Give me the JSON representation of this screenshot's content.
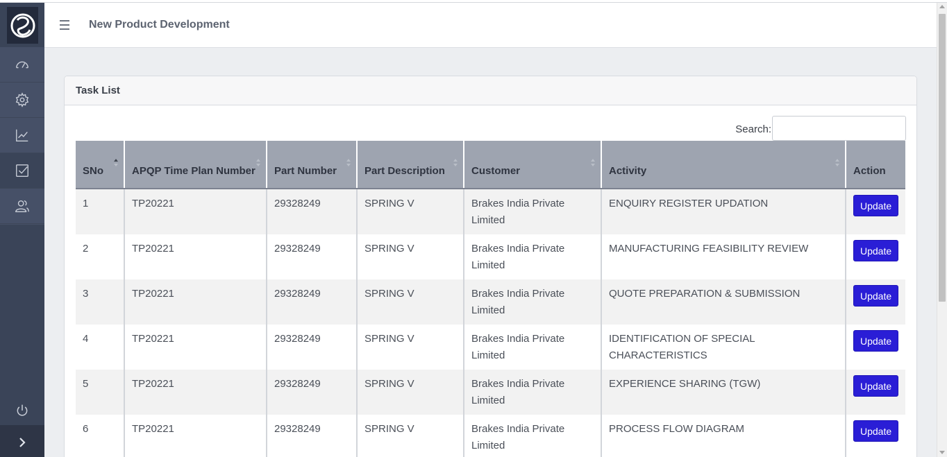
{
  "app": {
    "title": "New Product Development"
  },
  "sidebar": {
    "logo": "swirl-logo",
    "items": [
      {
        "name": "dashboard-icon",
        "label": "Dashboard"
      },
      {
        "name": "settings-icon",
        "label": "Settings"
      },
      {
        "name": "chart-icon",
        "label": "Reports"
      },
      {
        "name": "tasks-icon",
        "label": "Tasks",
        "active": true
      },
      {
        "name": "users-icon",
        "label": "Users"
      }
    ],
    "footer": [
      "power-icon",
      "chevron-right-icon"
    ]
  },
  "card": {
    "title": "Task List"
  },
  "search": {
    "label": "Search:",
    "value": ""
  },
  "table": {
    "columns": [
      "SNo",
      "APQP Time Plan Number",
      "Part Number",
      "Part Description",
      "Customer",
      "Activity",
      "Action"
    ],
    "rows": [
      {
        "sno": "1",
        "plan": "TP20221",
        "part": "29328249",
        "desc": "SPRING V",
        "customer": "Brakes India Private Limited",
        "activity": "ENQUIRY REGISTER UPDATION",
        "action": "Update"
      },
      {
        "sno": "2",
        "plan": "TP20221",
        "part": "29328249",
        "desc": "SPRING V",
        "customer": "Brakes India Private Limited",
        "activity": "MANUFACTURING FEASIBILITY REVIEW",
        "action": "Update"
      },
      {
        "sno": "3",
        "plan": "TP20221",
        "part": "29328249",
        "desc": "SPRING V",
        "customer": "Brakes India Private Limited",
        "activity": "QUOTE PREPARATION & SUBMISSION",
        "action": "Update"
      },
      {
        "sno": "4",
        "plan": "TP20221",
        "part": "29328249",
        "desc": "SPRING V",
        "customer": "Brakes India Private Limited",
        "activity": "IDENTIFICATION OF SPECIAL CHARACTERISTICS",
        "action": "Update"
      },
      {
        "sno": "5",
        "plan": "TP20221",
        "part": "29328249",
        "desc": "SPRING V",
        "customer": "Brakes India Private Limited",
        "activity": "EXPERIENCE SHARING (TGW)",
        "action": "Update"
      },
      {
        "sno": "6",
        "plan": "TP20221",
        "part": "29328249",
        "desc": "SPRING V",
        "customer": "Brakes India Private Limited",
        "activity": "PROCESS FLOW DIAGRAM",
        "action": "Update"
      }
    ]
  },
  "colors": {
    "sidebar": "#3a4458",
    "header_row": "#9ea4b0",
    "button": "#2a1ed6"
  }
}
